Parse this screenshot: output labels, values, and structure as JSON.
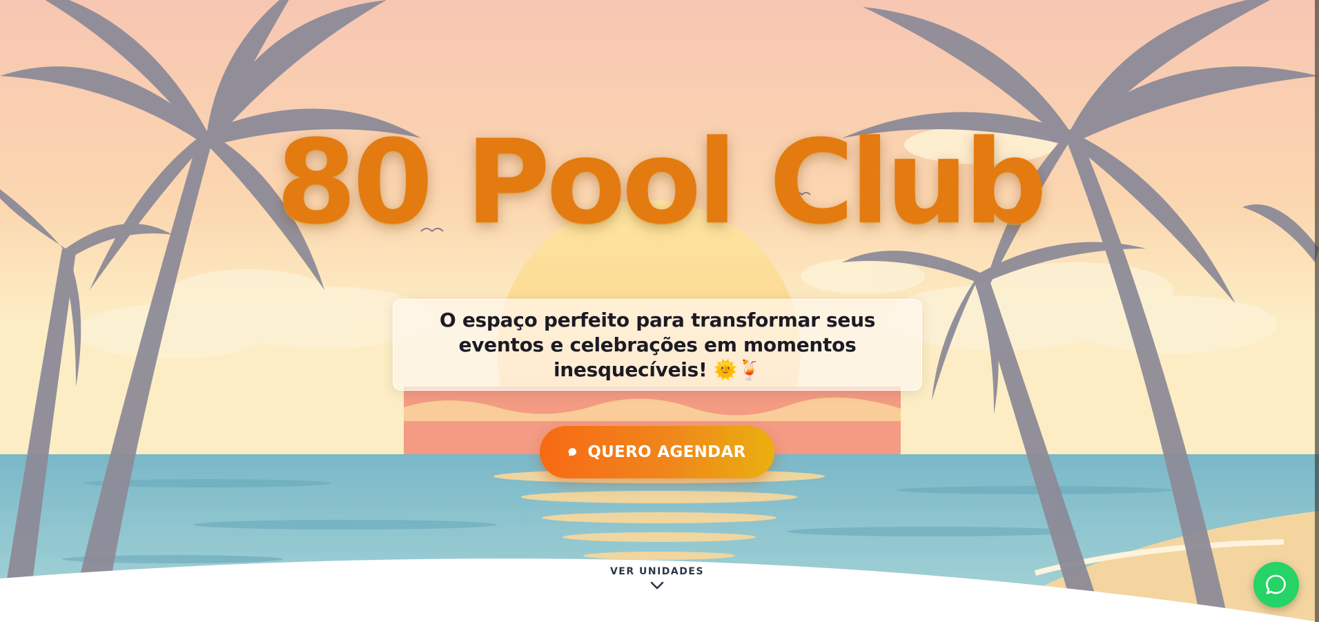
{
  "hero": {
    "title": "80 Pool Club",
    "tagline": "O espaço perfeito para transformar seus eventos e celebrações em momentos inesquecíveis! 🌞🍹",
    "cta_label": "QUERO AGENDAR",
    "cta_icon": "chat-bubble-icon"
  },
  "scroll_link": {
    "label": "VER UNIDADES",
    "icon": "chevron-down-icon"
  },
  "whatsapp": {
    "icon": "whatsapp-icon",
    "color": "#25d366"
  },
  "colors": {
    "accent": "#f0861c",
    "title": "#e47b10",
    "text_dark": "#1c1a24"
  }
}
